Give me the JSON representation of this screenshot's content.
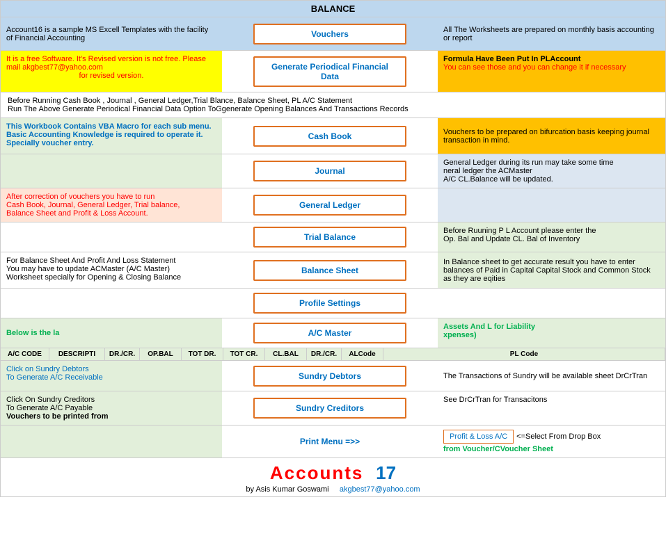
{
  "header": {
    "balance_label": "BALANCE"
  },
  "row1": {
    "left": "Account16 is a sample MS Excell Templates with the facility of Financial Accounting",
    "mid_btn": "Vouchers",
    "right": "All The Worksheets are prepared on monthly basis accounting or report"
  },
  "row2": {
    "left_line1": "It is a free Software. It's Revised version is not free.  Please mail akgbest77@yahoo.com",
    "left_line2": "for revised version.",
    "mid_btn": "Generate Periodical Financial Data",
    "right_line1": "Formula Have Been Put In PLAccount",
    "right_line2": "You can see those and you can change it if necessary"
  },
  "info_text": {
    "line1": "Before Running Cash Book , Journal , General Ledger,Trial Blance, Balance Sheet, PL A/C Statement",
    "line2": "Run The Above Generate Periodical Financial Data Option ToGgenerate Opening Balances And Transactions Records"
  },
  "row_cashbook": {
    "left": "This Workbook Contains VBA Macro for each sub menu. Basic Accounting Knowledge is required to operate it. Specially voucher entry.",
    "mid_btn": "Cash Book",
    "right": "Vouchers to be prepared on bifurcation basis keeping journal transaction in mind."
  },
  "row_journal": {
    "left": "",
    "mid_btn": "Journal",
    "right_line1": "General Ledger during its run may take some time",
    "right_line2": "neral ledger the ACMaster",
    "right_line3": "A/C CL.Balance will be updated."
  },
  "row_gl": {
    "left_line1": "After correction of vouchers you have to run",
    "left_line2": "Cash Book, Journal, General Ledger, Trial balance,",
    "left_line3": "Balance Sheet and Profit & Loss Account.",
    "mid_btn": "General Ledger"
  },
  "row_trial": {
    "mid_btn": "Trial Balance",
    "right_line1": "Before Ruuning P L Account please enter the",
    "right_line2": "Op. Bal and Update CL. Bal of Inventory"
  },
  "row_balance": {
    "left_line1": "For Balance Sheet And Profit And Loss Statement",
    "left_line2": "You may have to update ACMaster (A/C Master)",
    "left_line3": "Worksheet specially for Opening & Closing Balance",
    "mid_btn": "Balance Sheet",
    "right": "In Balance sheet to get accurate result you have to enter balances of Paid in Capital Capital Stock and Common Stock as they are eqities"
  },
  "row_profile": {
    "mid_btn": "Profile Settings"
  },
  "row_acmaster_info": {
    "left": "Below is the la",
    "right_left": "Assets And L for Liability",
    "right_right": "xpenses)"
  },
  "row_acmaster": {
    "mid_btn": "A/C Master"
  },
  "acmaster_cols": {
    "col1": "A/C CODE",
    "col2": "DESCRIPTI",
    "col3": "DR./CR.",
    "col4": "OP.BAL",
    "col5": "TOT DR.",
    "col6": "TOT CR.",
    "col7": "CL.BAL",
    "col8": "DR./CR.",
    "col9": "ALCode",
    "col10": "PL Code"
  },
  "row_sundry_debtors": {
    "left_line1": "Click on Sundry Debtors",
    "left_line2": "To Generate A/C Receivable",
    "mid_btn": "Sundry Debtors",
    "right": "The Transactions of Sundry will be available sheet DrCrTran"
  },
  "row_sundry_creditors": {
    "left_line1": "Click On Sundry Creditors",
    "left_line2": "To Generate A/C Payable",
    "left_line3": "Vouchers to be printed from",
    "mid_btn": "Sundry Creditors",
    "right_line1": "See DrCrTran for Transacitons"
  },
  "row_print": {
    "mid_label": "Print Menu =>>",
    "right_btn": "Profit & Loss A/C",
    "right_text": "<=Select From Drop Box",
    "right_line2": "from Voucher/CVoucher Sheet"
  },
  "footer": {
    "title": "Accounts",
    "number": "17",
    "by": "by Asis Kumar Goswami",
    "email": "akgbest77@yahoo.com"
  }
}
